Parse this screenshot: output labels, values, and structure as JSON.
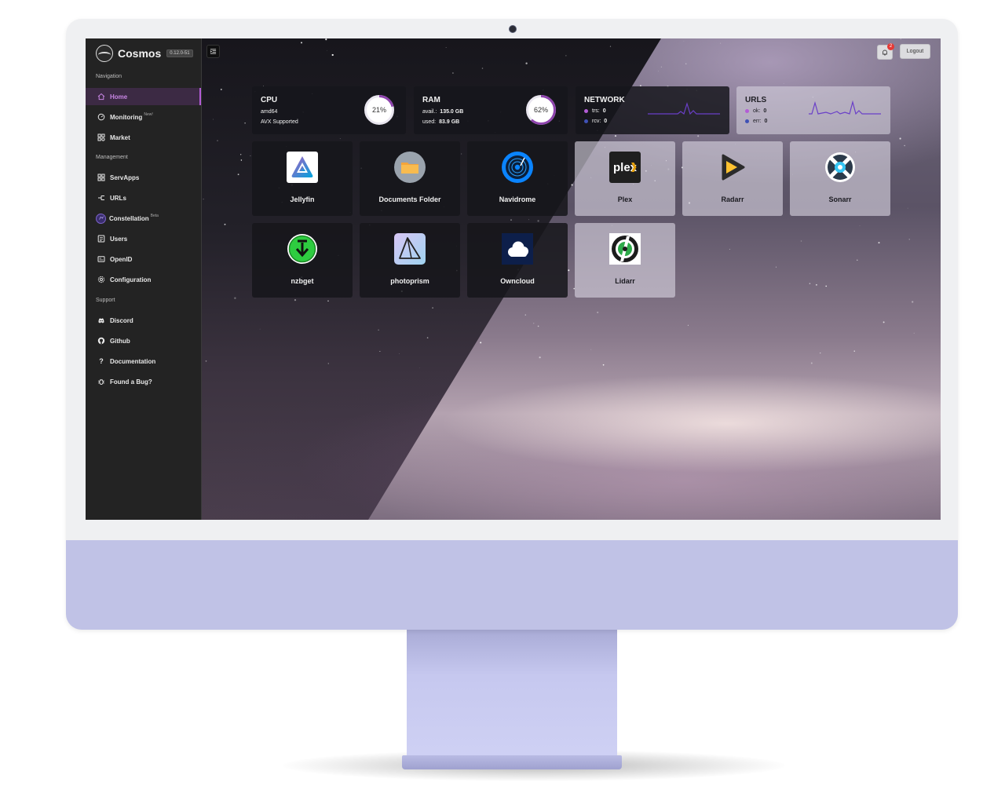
{
  "app": {
    "name": "Cosmos",
    "version": "0.12.0-51"
  },
  "sidebar": {
    "sections": {
      "navigation": "Navigation",
      "management": "Management",
      "support": "Support"
    },
    "items": [
      {
        "label": "Home",
        "icon": "home-icon",
        "active": true
      },
      {
        "label": "Monitoring",
        "icon": "dashboard-icon",
        "tag": "New!"
      },
      {
        "label": "Market",
        "icon": "apps-icon"
      },
      {
        "label": "ServApps",
        "icon": "grid-icon"
      },
      {
        "label": "URLs",
        "icon": "link-icon"
      },
      {
        "label": "Constellation",
        "icon": "constellation-icon",
        "tag": "Beta"
      },
      {
        "label": "Users",
        "icon": "user-icon"
      },
      {
        "label": "OpenID",
        "icon": "id-card-icon"
      },
      {
        "label": "Configuration",
        "icon": "gear-icon"
      },
      {
        "label": "Discord",
        "icon": "discord-icon"
      },
      {
        "label": "Github",
        "icon": "github-icon"
      },
      {
        "label": "Documentation",
        "icon": "question-icon"
      },
      {
        "label": "Found a Bug?",
        "icon": "bug-icon"
      }
    ]
  },
  "topbar": {
    "notification_count": "2",
    "logout_label": "Logout"
  },
  "stats": {
    "cpu": {
      "title": "CPU",
      "arch": "amd64",
      "feature": "AVX Supported",
      "usage": "21%",
      "usage_value": 21
    },
    "ram": {
      "title": "RAM",
      "avail_label": "avail.:",
      "avail": "135.0 GB",
      "used_label": "used:",
      "used": "83.9 GB",
      "usage": "62%",
      "usage_value": 62
    },
    "network": {
      "title": "NETWORK",
      "trs_label": "trs:",
      "trs": "0",
      "rcv_label": "rcv:",
      "rcv": "0"
    },
    "urls": {
      "title": "URLS",
      "ok_label": "ok:",
      "ok": "0",
      "err_label": "err:",
      "err": "0"
    }
  },
  "apps": [
    {
      "label": "Jellyfin",
      "icon": "jellyfin-icon"
    },
    {
      "label": "Documents Folder",
      "icon": "folder-icon"
    },
    {
      "label": "Navidrome",
      "icon": "navidrome-icon"
    },
    {
      "label": "Plex",
      "icon": "plex-icon",
      "icon_text": "plex"
    },
    {
      "label": "Radarr",
      "icon": "radarr-icon"
    },
    {
      "label": "Sonarr",
      "icon": "sonarr-icon"
    },
    {
      "label": "nzbget",
      "icon": "nzbget-icon"
    },
    {
      "label": "photoprism",
      "icon": "photoprism-icon"
    },
    {
      "label": "Owncloud",
      "icon": "owncloud-icon"
    },
    {
      "label": "Lidarr",
      "icon": "lidarr-icon"
    }
  ],
  "colors": {
    "accent": "#b35cd6",
    "monitor_chin": "#c0c2e6",
    "sidebar_bg": "#232323",
    "trs_dot": "#b35cd6",
    "rcv_dot": "#3f51b5",
    "sparkline": "#6a3fc8"
  }
}
